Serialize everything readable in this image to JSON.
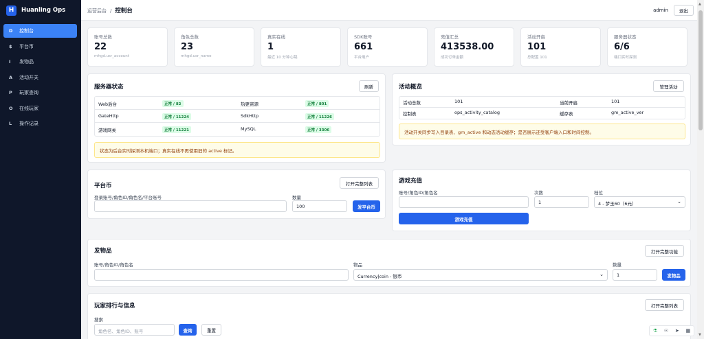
{
  "brand": {
    "logo_letter": "H",
    "name": "Huanling Ops"
  },
  "nav": [
    {
      "icon": "D",
      "label": "控制台",
      "active": true
    },
    {
      "icon": "$",
      "label": "平台币"
    },
    {
      "icon": "I",
      "label": "发物品"
    },
    {
      "icon": "A",
      "label": "活动开关"
    },
    {
      "icon": "P",
      "label": "玩家查询"
    },
    {
      "icon": "O",
      "label": "在线玩家"
    },
    {
      "icon": "L",
      "label": "操作记录"
    }
  ],
  "topbar": {
    "parent": "运营后台",
    "separator": "/",
    "current": "控制台",
    "user": "admin",
    "logout": "退出"
  },
  "stats": [
    {
      "label": "账号总数",
      "value": "22",
      "hint": "mhgd.usr_account"
    },
    {
      "label": "角色总数",
      "value": "23",
      "hint": "mhgd.usr_name"
    },
    {
      "label": "真实在线",
      "value": "1",
      "hint": "最近 10 分钟心跳"
    },
    {
      "label": "SDK账号",
      "value": "661",
      "hint": "平台用户"
    },
    {
      "label": "充值汇总",
      "value": "413538.00",
      "hint": "成功订单金额"
    },
    {
      "label": "活动开启",
      "value": "101",
      "hint": "总配置 101"
    },
    {
      "label": "服务器状态",
      "value": "6/6",
      "hint": "端口实时探测"
    }
  ],
  "server_status": {
    "title": "服务器状态",
    "refresh": "刷新",
    "rows": [
      {
        "name1": "Web后台",
        "status1": "正常 / 82",
        "name2": "热更资源",
        "status2": "正常 / 801"
      },
      {
        "name1": "GateHttp",
        "status1": "正常 / 11224",
        "name2": "SdkHttp",
        "status2": "正常 / 11226"
      },
      {
        "name1": "游戏网关",
        "status1": "正常 / 11221",
        "name2": "MySQL",
        "status2": "正常 / 3306"
      }
    ],
    "note": "状态为后台实时探测本机端口；真实在线不再使用旧的 active 标记。"
  },
  "activity": {
    "title": "活动概览",
    "manage": "管理活动",
    "rows": [
      {
        "k1": "活动总数",
        "v1": "101",
        "k2": "当前开启",
        "v2": "101"
      },
      {
        "k1": "控制表",
        "v1": "ops_activity_catalog",
        "k2": "缓存表",
        "v2": "gm_active_ver"
      }
    ],
    "note": "活动开关同步写入目录表、gm_active 和动态活动缓存；是否展示还受客户端入口和时间控制。"
  },
  "platform_coin": {
    "title": "平台币",
    "open_list": "打开完整列表",
    "account_label": "登录账号/角色ID/角色名/平台账号",
    "account_value": "",
    "amount_label": "数量",
    "amount_value": "100",
    "submit": "发平台币"
  },
  "recharge": {
    "title": "游戏充值",
    "account_label": "账号/角色ID/角色名",
    "account_value": "",
    "times_label": "次数",
    "times_value": "1",
    "tier_label": "档位",
    "tier_value": "4 - 梦玉60（6元）",
    "submit": "游戏充值"
  },
  "send_item": {
    "title": "发物品",
    "open_full": "打开完整功能",
    "account_label": "账号/角色ID/角色名",
    "account_value": "",
    "item_label": "物品",
    "item_value": "Currency|coin - 银币",
    "qty_label": "数量",
    "qty_value": "1",
    "submit": "发物品"
  },
  "ranking": {
    "title": "玩家排行与信息",
    "open_full": "打开完整列表",
    "search_label": "搜索",
    "search_placeholder": "角色名、角色ID、账号",
    "query": "查询",
    "reset": "重置"
  },
  "colors": {
    "sidebar": "#0f172a",
    "active_nav": "#3b82f6",
    "primary": "#2563eb",
    "ok_text": "#15803d",
    "ok_bg": "#dcfce7",
    "note_bg": "#fefce8"
  }
}
